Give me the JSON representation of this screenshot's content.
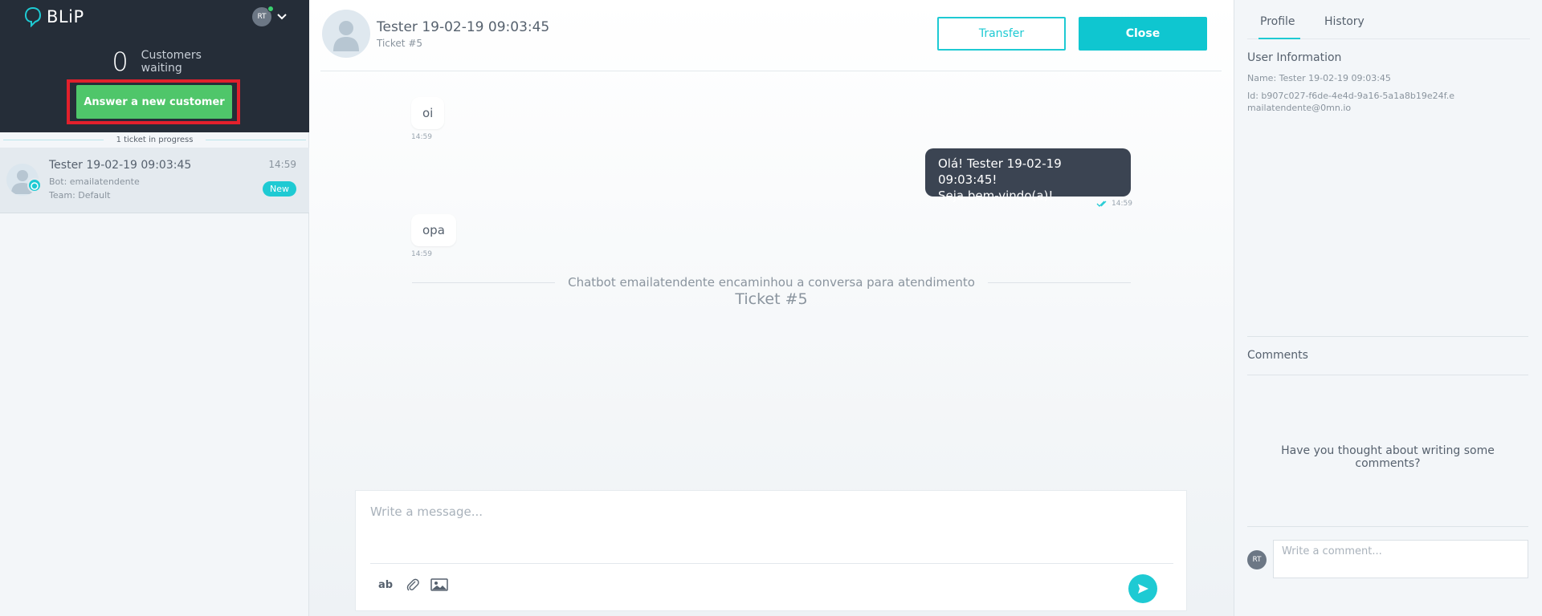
{
  "brand": {
    "name": "BLiP"
  },
  "user": {
    "initials": "RT"
  },
  "queue": {
    "waiting_count": "0",
    "waiting_label": "Customers waiting",
    "answer_button": "Answer a new customer",
    "in_progress_label": "1 ticket in progress"
  },
  "tickets": [
    {
      "name": "Tester 19-02-19 09:03:45",
      "bot": "Bot: emailatendente",
      "team": "Team: Default",
      "time": "14:59",
      "badge": "New"
    }
  ],
  "chat": {
    "header": {
      "name": "Tester 19-02-19 09:03:45",
      "ticket": "Ticket #5"
    },
    "transfer_button": "Transfer",
    "close_button": "Close",
    "messages": [
      {
        "direction": "in",
        "text": "oi",
        "time": "14:59"
      },
      {
        "direction": "out",
        "line1": "Olá! Tester 19-02-19 09:03:45!",
        "line2": "Seja bem-vindo(a)!",
        "time": "14:59"
      },
      {
        "direction": "in",
        "text": "opa",
        "time": "14:59"
      }
    ],
    "system_message": "Chatbot emailatendente encaminhou a conversa para atendimento",
    "system_ticket": "Ticket #5",
    "composer": {
      "placeholder": "Write a message...",
      "text_tool": "ab"
    }
  },
  "profile_panel": {
    "tabs": [
      "Profile",
      "History"
    ],
    "user_info_title": "User Information",
    "name_line": "Name: Tester 19-02-19 09:03:45",
    "id_line": "Id: b907c027-f6de-4e4d-9a16-5a1a8b19e24f.emailatendente@0mn.io",
    "comments_title": "Comments",
    "empty_comments": "Have you thought about writing some comments?",
    "comment_placeholder": "Write a comment..."
  },
  "colors": {
    "accent": "#1ecad3",
    "answer_green": "#4fc66a",
    "highlight_red": "#e2202c",
    "sidebar_dark": "#252d38",
    "outgoing_bubble": "#3b4452"
  }
}
